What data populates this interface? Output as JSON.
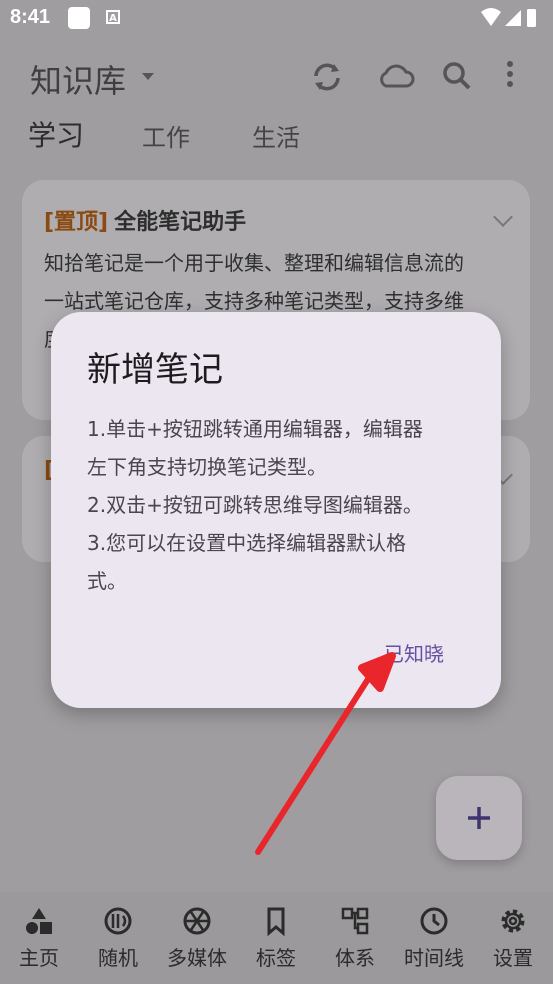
{
  "status": {
    "time": "8:41",
    "badge": "A"
  },
  "header": {
    "title": "知识库"
  },
  "tabs": [
    "学习",
    "工作",
    "生活"
  ],
  "card1": {
    "pin": "[置顶]",
    "title": "全能笔记助手",
    "body_lines": [
      "知拾笔记是一个用于收集、整理和编辑信息流的",
      "一站式笔记仓库，支持多种笔记类型，支持多维",
      "度"
    ]
  },
  "card2": {
    "pin": "["
  },
  "dialog": {
    "title": "新增笔记",
    "lines": [
      "1.单击+按钮跳转通用编辑器，编辑器",
      "左下角支持切换笔记类型。",
      "2.双击+按钮可跳转思维导图编辑器。",
      "3.您可以在设置中选择编辑器默认格",
      "式。"
    ],
    "ok": "已知晓"
  },
  "fab": {
    "label": "+"
  },
  "nav": [
    {
      "label": "主页",
      "icon": "shapes-icon"
    },
    {
      "label": "随机",
      "icon": "random-icon"
    },
    {
      "label": "多媒体",
      "icon": "aperture-icon"
    },
    {
      "label": "标签",
      "icon": "bookmark-icon"
    },
    {
      "label": "体系",
      "icon": "hierarchy-icon"
    },
    {
      "label": "时间线",
      "icon": "clock-icon"
    },
    {
      "label": "设置",
      "icon": "gear-icon"
    }
  ],
  "colors": {
    "accent": "#6750a4",
    "pin": "#8a4a12",
    "arrow": "#e8262b"
  }
}
